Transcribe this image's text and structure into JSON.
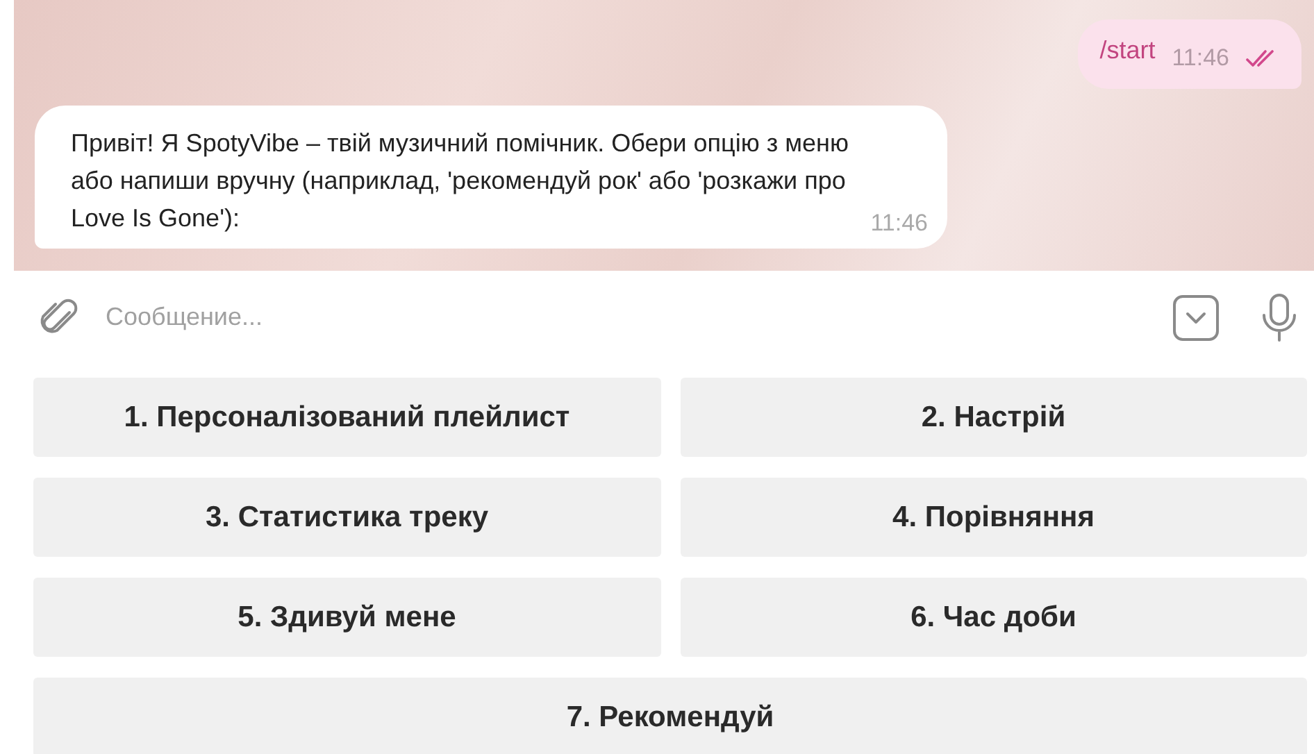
{
  "messages": [
    {
      "kind": "outgoing",
      "text": "/start",
      "time": "11:46",
      "read": true
    },
    {
      "kind": "incoming",
      "text": "Привіт! Я SpotyVibe – твій музичний помічник. Обери опцію з меню або напиши вручну (наприклад, 'рекомендуй рок' або 'розкажи про Love Is Gone'):",
      "time": "11:46"
    }
  ],
  "composer": {
    "placeholder": "Сообщение..."
  },
  "keyboard": [
    "1. Персоналізований плейлист",
    "2. Настрій",
    "3. Статистика треку",
    "4. Порівняння",
    "5. Здивуй мене",
    "6. Час доби",
    "7. Рекомендуй"
  ]
}
